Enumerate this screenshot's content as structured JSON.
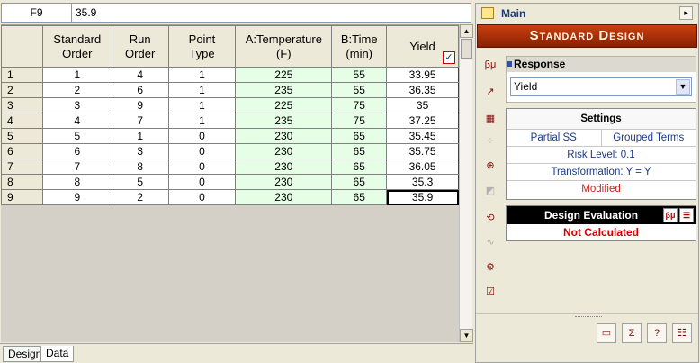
{
  "formula_bar": {
    "cell_ref": "F9",
    "value": "35.9"
  },
  "grid": {
    "columns": [
      {
        "l1": "Standard",
        "l2": "Order"
      },
      {
        "l1": "Run",
        "l2": "Order"
      },
      {
        "l1": "Point",
        "l2": "Type"
      },
      {
        "l1": "A:Temperature",
        "l2": "(F)"
      },
      {
        "l1": "B:Time",
        "l2": "(min)"
      },
      {
        "l1": "Yield",
        "l2": ""
      }
    ],
    "rows": [
      {
        "n": "1",
        "c": [
          "1",
          "4",
          "1",
          "225",
          "55",
          "33.95"
        ]
      },
      {
        "n": "2",
        "c": [
          "2",
          "6",
          "1",
          "235",
          "55",
          "36.35"
        ]
      },
      {
        "n": "3",
        "c": [
          "3",
          "9",
          "1",
          "225",
          "75",
          "35"
        ]
      },
      {
        "n": "4",
        "c": [
          "4",
          "7",
          "1",
          "235",
          "75",
          "37.25"
        ]
      },
      {
        "n": "5",
        "c": [
          "5",
          "1",
          "0",
          "230",
          "65",
          "35.45"
        ]
      },
      {
        "n": "6",
        "c": [
          "6",
          "3",
          "0",
          "230",
          "65",
          "35.75"
        ]
      },
      {
        "n": "7",
        "c": [
          "7",
          "8",
          "0",
          "230",
          "65",
          "36.05"
        ]
      },
      {
        "n": "8",
        "c": [
          "8",
          "5",
          "0",
          "230",
          "65",
          "35.3"
        ]
      },
      {
        "n": "9",
        "c": [
          "9",
          "2",
          "0",
          "230",
          "65",
          "35.9"
        ]
      }
    ],
    "yield_check": "✓"
  },
  "tabs": [
    {
      "label": "Design"
    },
    {
      "label": "Data"
    }
  ],
  "panel": {
    "title": "Main",
    "banner": "Standard Design",
    "response": {
      "label": "Response",
      "selected": "Yield"
    },
    "settings": {
      "title": "Settings",
      "partial_ss": "Partial SS",
      "grouped_terms": "Grouped Terms",
      "risk_level": "Risk Level: 0.1",
      "transformation": "Transformation: Y = Y",
      "status": "Modified"
    },
    "evaluation": {
      "title": "Design Evaluation",
      "status": "Not Calculated"
    }
  },
  "colors": {
    "accent": "#c84010",
    "factor_bg": "#e6fde6",
    "alert": "#d00000"
  }
}
